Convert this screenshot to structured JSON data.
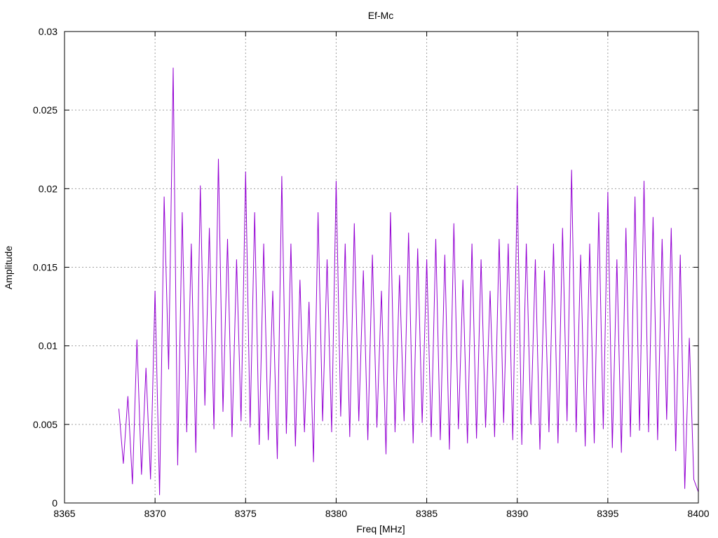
{
  "chart_data": {
    "type": "line",
    "title": "Ef-Mc",
    "xlabel": "Freq [MHz]",
    "ylabel": "Amplitude",
    "xlim": [
      8365,
      8400
    ],
    "ylim": [
      0,
      0.03
    ],
    "grid": true,
    "x_ticks": [
      8365,
      8370,
      8375,
      8380,
      8385,
      8390,
      8395,
      8400
    ],
    "x_tick_labels": [
      "8365",
      "8370",
      "8375",
      "8380",
      "8385",
      "8390",
      "8395",
      "8400"
    ],
    "y_ticks": [
      0,
      0.005,
      0.01,
      0.015,
      0.02,
      0.025,
      0.03
    ],
    "y_tick_labels": [
      "0",
      "0.005",
      "0.01",
      "0.015",
      "0.02",
      "0.025",
      "0.03"
    ],
    "series": [
      {
        "color": "#9400d3",
        "x": [
          8368.0,
          8368.25,
          8368.5,
          8368.75,
          8369.0,
          8369.25,
          8369.5,
          8369.75,
          8370.0,
          8370.25,
          8370.5,
          8370.75,
          8371.0,
          8371.25,
          8371.5,
          8371.75,
          8372.0,
          8372.25,
          8372.5,
          8372.75,
          8373.0,
          8373.25,
          8373.5,
          8373.75,
          8374.0,
          8374.25,
          8374.5,
          8374.75,
          8375.0,
          8375.25,
          8375.5,
          8375.75,
          8376.0,
          8376.25,
          8376.5,
          8376.75,
          8377.0,
          8377.25,
          8377.5,
          8377.75,
          8378.0,
          8378.25,
          8378.5,
          8378.75,
          8379.0,
          8379.25,
          8379.5,
          8379.75,
          8380.0,
          8380.25,
          8380.5,
          8380.75,
          8381.0,
          8381.25,
          8381.5,
          8381.75,
          8382.0,
          8382.25,
          8382.5,
          8382.75,
          8383.0,
          8383.25,
          8383.5,
          8383.75,
          8384.0,
          8384.25,
          8384.5,
          8384.75,
          8385.0,
          8385.25,
          8385.5,
          8385.75,
          8386.0,
          8386.25,
          8386.5,
          8386.75,
          8387.0,
          8387.25,
          8387.5,
          8387.75,
          8388.0,
          8388.25,
          8388.5,
          8388.75,
          8389.0,
          8389.25,
          8389.5,
          8389.75,
          8390.0,
          8390.25,
          8390.5,
          8390.75,
          8391.0,
          8391.25,
          8391.5,
          8391.75,
          8392.0,
          8392.25,
          8392.5,
          8392.75,
          8393.0,
          8393.25,
          8393.5,
          8393.75,
          8394.0,
          8394.25,
          8394.5,
          8394.75,
          8395.0,
          8395.25,
          8395.5,
          8395.75,
          8396.0,
          8396.25,
          8396.5,
          8396.75,
          8397.0,
          8397.25,
          8397.5,
          8397.75,
          8398.0,
          8398.25,
          8398.5,
          8398.75,
          8399.0,
          8399.25,
          8399.5,
          8399.75,
          8400.0
        ],
        "y": [
          0.006,
          0.0025,
          0.0068,
          0.0012,
          0.0104,
          0.0018,
          0.0086,
          0.0015,
          0.0135,
          0.0005,
          0.0195,
          0.0085,
          0.0277,
          0.0024,
          0.0185,
          0.0045,
          0.0165,
          0.0032,
          0.0202,
          0.0062,
          0.0175,
          0.0047,
          0.0219,
          0.0058,
          0.0168,
          0.0042,
          0.0155,
          0.0052,
          0.0211,
          0.0048,
          0.0185,
          0.0037,
          0.0165,
          0.004,
          0.0135,
          0.0028,
          0.0208,
          0.0044,
          0.0165,
          0.0036,
          0.0142,
          0.0045,
          0.0128,
          0.0026,
          0.0185,
          0.0052,
          0.0155,
          0.0045,
          0.0205,
          0.0055,
          0.0165,
          0.0042,
          0.0178,
          0.0052,
          0.0148,
          0.004,
          0.0158,
          0.0048,
          0.0135,
          0.0031,
          0.0185,
          0.0045,
          0.0145,
          0.0052,
          0.0172,
          0.0038,
          0.0162,
          0.0051,
          0.0155,
          0.0042,
          0.0168,
          0.004,
          0.0158,
          0.0034,
          0.0178,
          0.0047,
          0.0142,
          0.0038,
          0.0165,
          0.0041,
          0.0155,
          0.0048,
          0.0135,
          0.0042,
          0.0168,
          0.0051,
          0.0165,
          0.004,
          0.0202,
          0.0037,
          0.0165,
          0.005,
          0.0155,
          0.0034,
          0.0148,
          0.0045,
          0.0165,
          0.0038,
          0.0175,
          0.0052,
          0.0212,
          0.0045,
          0.0158,
          0.0036,
          0.0165,
          0.0038,
          0.0185,
          0.0047,
          0.0198,
          0.0035,
          0.0155,
          0.0032,
          0.0175,
          0.0042,
          0.0195,
          0.0046,
          0.0205,
          0.0045,
          0.0182,
          0.004,
          0.0168,
          0.0053,
          0.0175,
          0.0033,
          0.0158,
          0.0009,
          0.0105,
          0.0015,
          0.0007
        ]
      }
    ]
  }
}
